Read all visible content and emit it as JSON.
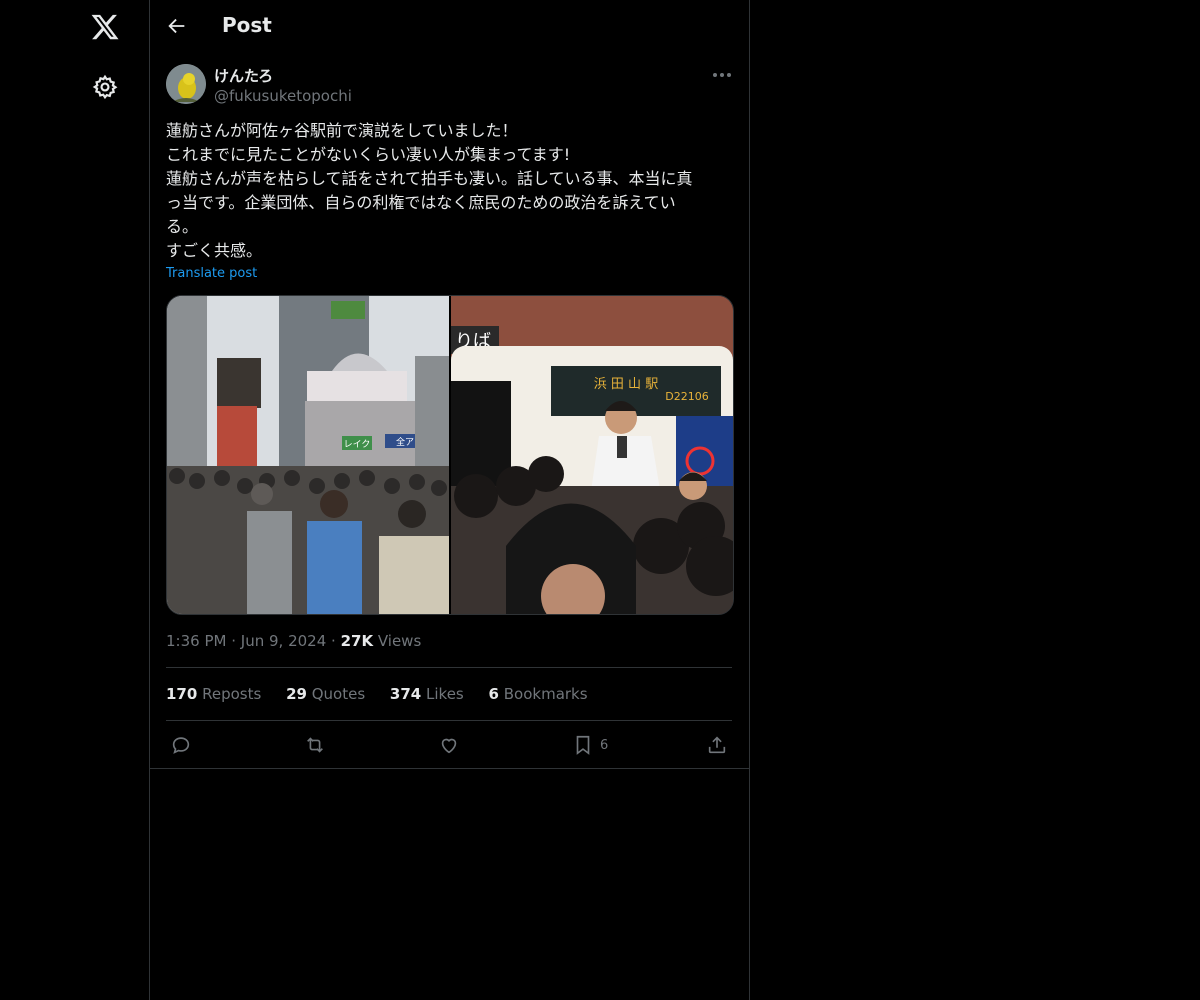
{
  "header": {
    "title": "Post"
  },
  "post": {
    "author_name": "けんたろ",
    "handle": "@fukusuketopochi",
    "text_lines": [
      "蓮舫さんが阿佐ヶ谷駅前で演説をしていました！",
      "これまでに見たことがないくらい凄い人が集まってます!",
      "蓮舫さんが声を枯らして話をされて拍手も凄い。話している事、本当に真",
      "っ当です。企業団体、自らの利権ではなく庶民のための政治を訴えてい",
      "る。",
      "すごく共感。"
    ],
    "translate_label": "Translate post",
    "time": "1:36 PM",
    "date": "Jun 9, 2024",
    "views_count": "27K",
    "views_label": "Views",
    "stats": {
      "reposts_count": "170",
      "reposts_label": "Reposts",
      "quotes_count": "29",
      "quotes_label": "Quotes",
      "likes_count": "374",
      "likes_label": "Likes",
      "bookmarks_count": "6",
      "bookmarks_label": "Bookmarks"
    },
    "bookmark_action_count": "6"
  },
  "media": {
    "left_sign_a": "レイク",
    "left_sign_b": "全ア",
    "right_sign_top": "りば",
    "bus_destination": "浜 田 山 駅",
    "bus_number": "D22106"
  },
  "icons": {
    "logo": "x-logo-icon",
    "settings": "gear-icon",
    "back": "arrow-left-icon",
    "more": "more-horizontal-icon",
    "reply": "reply-icon",
    "repost": "repost-icon",
    "like": "heart-icon",
    "bookmark": "bookmark-icon",
    "share": "share-icon"
  },
  "colors": {
    "background": "#000000",
    "text": "#e7e9ea",
    "secondary": "#71767b",
    "link": "#1d9bf0",
    "border": "#2f3336"
  }
}
